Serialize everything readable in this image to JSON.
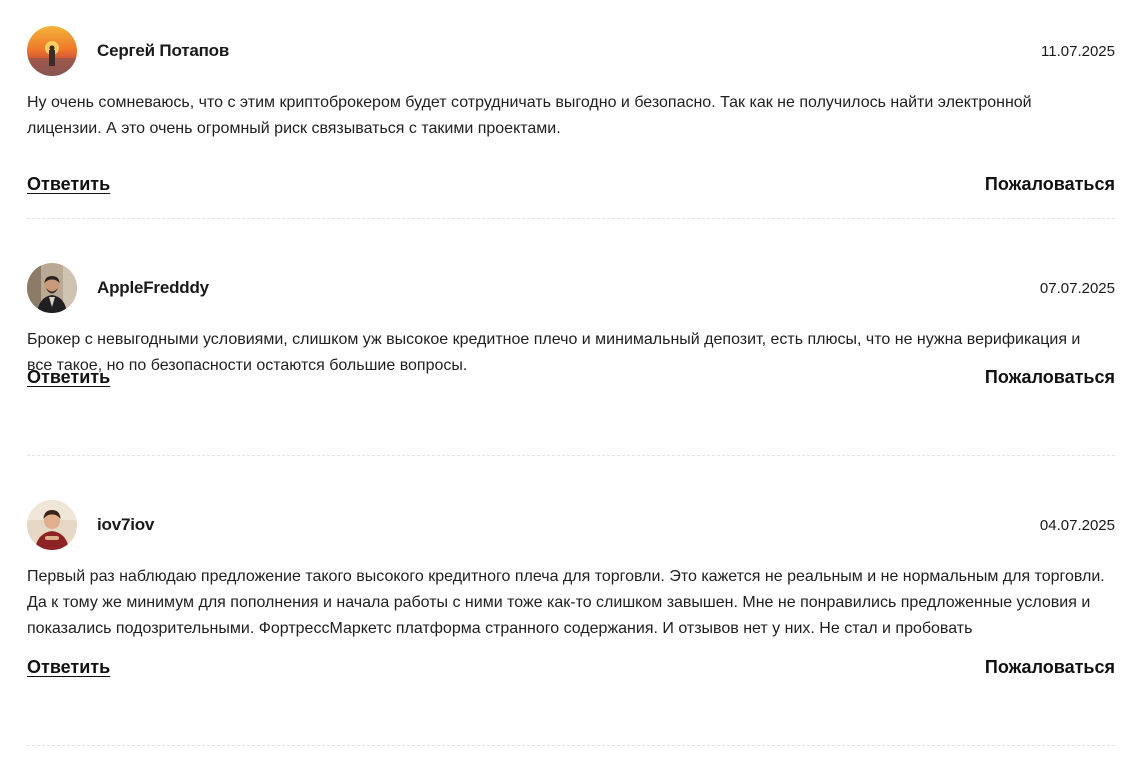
{
  "comments": [
    {
      "author": "Сергей Потапов",
      "date": "11.07.2025",
      "text": "Ну очень сомневаюсь, что с этим криптоброкером будет сотрудничать выгодно и безопасно. Так как не получилось найти электронной лицензии. А это очень огромный риск связываться с такими проектами.",
      "reply_label": "Ответить",
      "complain_label": "Пожаловаться"
    },
    {
      "author": "AppleFredddy",
      "date": "07.07.2025",
      "text": "Брокер с невыгодными условиями, слишком уж высокое кредитное плечо и минимальный депозит, есть плюсы, что не нужна верификация и все такое, но по безопасности остаются большие вопросы.",
      "reply_label": "Ответить",
      "complain_label": "Пожаловаться"
    },
    {
      "author": "iov7iov",
      "date": "04.07.2025",
      "text": "Первый раз наблюдаю предложение такого высокого кредитного плеча для торговли. Это кажется не реальным и не нормальным для торговли. Да к тому же минимум для пополнения и начала работы с ними тоже как-то слишком завышен. Мне не понравились предложенные условия и показались подозрительными. ФортрессМаркетс платформа странного содержания. И отзывов нет у них. Не стал и пробовать",
      "reply_label": "Ответить",
      "complain_label": "Пожаловаться"
    }
  ]
}
